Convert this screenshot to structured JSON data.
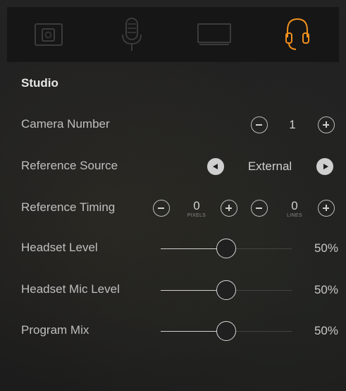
{
  "tabs": [
    {
      "icon": "camera-icon",
      "active": false
    },
    {
      "icon": "microphone-icon",
      "active": false
    },
    {
      "icon": "monitor-icon",
      "active": false
    },
    {
      "icon": "headphones-icon",
      "active": true
    }
  ],
  "accent_color": "#f0901e",
  "section_title": "Studio",
  "camera_number": {
    "label": "Camera Number",
    "value": "1"
  },
  "reference_source": {
    "label": "Reference Source",
    "value": "External"
  },
  "reference_timing": {
    "label": "Reference Timing",
    "pixels_value": "0",
    "pixels_unit": "PIXELS",
    "lines_value": "0",
    "lines_unit": "LINES"
  },
  "sliders": [
    {
      "label": "Headset Level",
      "value_text": "50%",
      "fraction": 0.5
    },
    {
      "label": "Headset Mic Level",
      "value_text": "50%",
      "fraction": 0.5
    },
    {
      "label": "Program Mix",
      "value_text": "50%",
      "fraction": 0.5
    }
  ]
}
